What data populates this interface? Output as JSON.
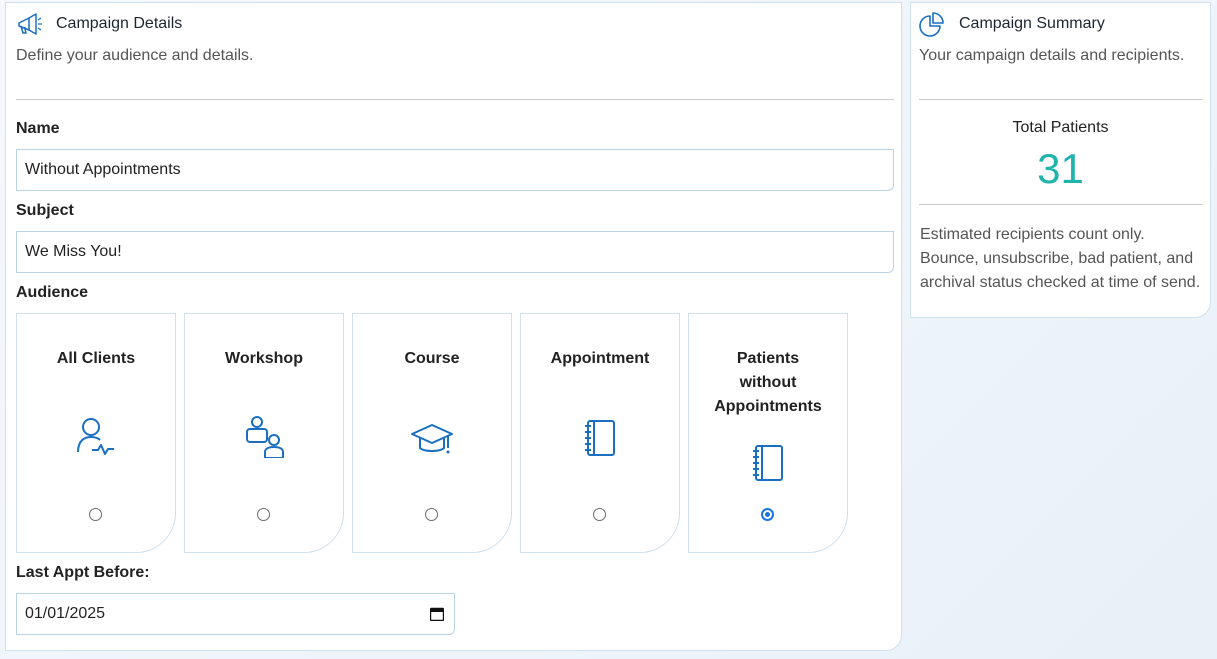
{
  "details": {
    "title": "Campaign Details",
    "subtitle": "Define your audience and details.",
    "name_label": "Name",
    "name_value": "Without Appointments",
    "subject_label": "Subject",
    "subject_value": "We Miss You!",
    "audience_label": "Audience",
    "audience_options": [
      {
        "label": "All Clients",
        "icon": "user-heartbeat-icon",
        "selected": false
      },
      {
        "label": "Workshop",
        "icon": "group-users-icon",
        "selected": false
      },
      {
        "label": "Course",
        "icon": "graduation-cap-icon",
        "selected": false
      },
      {
        "label": "Appointment",
        "icon": "notebook-icon",
        "selected": false
      },
      {
        "label": "Patients without Appointments",
        "icon": "notebook-icon",
        "selected": true
      }
    ],
    "last_appt_label": "Last Appt Before:",
    "last_appt_value": "01/01/2025",
    "accent_color": "#1a73e8"
  },
  "summary": {
    "title": "Campaign Summary",
    "subtitle": "Your campaign details and recipients.",
    "total_label": "Total Patients",
    "total_value": "31",
    "total_color": "#1fb3ad",
    "note": "Estimated recipients count only. Bounce, unsubscribe, bad patient, and archival status checked at time of send."
  }
}
